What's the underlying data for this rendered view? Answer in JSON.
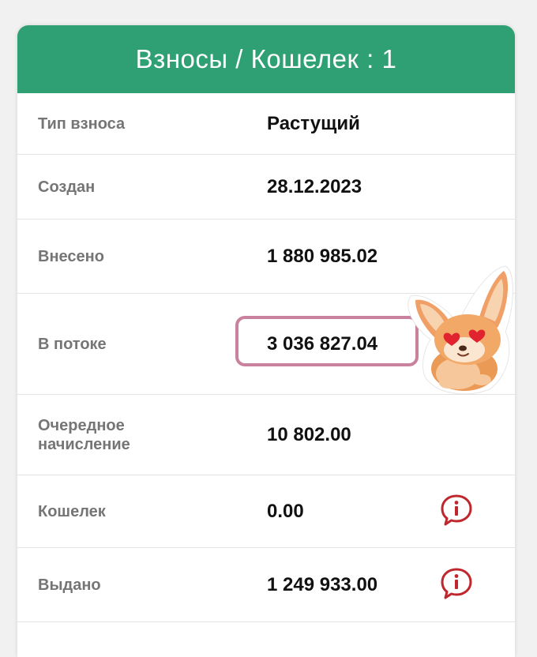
{
  "header": {
    "title": "Взносы / Кошелек : 1"
  },
  "rows": [
    {
      "label": "Тип взноса",
      "value": "Растущий"
    },
    {
      "label": "Создан",
      "value": "28.12.2023"
    },
    {
      "label": "Внесено",
      "value": "1 880 985.02"
    },
    {
      "label": "В потоке",
      "value": "3 036 827.04"
    },
    {
      "label": "Очередное\nначисление",
      "value": "10 802.00"
    },
    {
      "label": "Кошелек",
      "value": "0.00",
      "icon": "info-speech-bubble-icon"
    },
    {
      "label": "Выдано",
      "value": "1 249 933.00",
      "icon": "info-speech-bubble-icon"
    }
  ],
  "colors": {
    "header_bg": "#2fa074",
    "highlight_border": "#c9819d",
    "info_icon": "#c0272d"
  },
  "sticker": {
    "icon": "fox-with-heart-eyes-sticker"
  }
}
